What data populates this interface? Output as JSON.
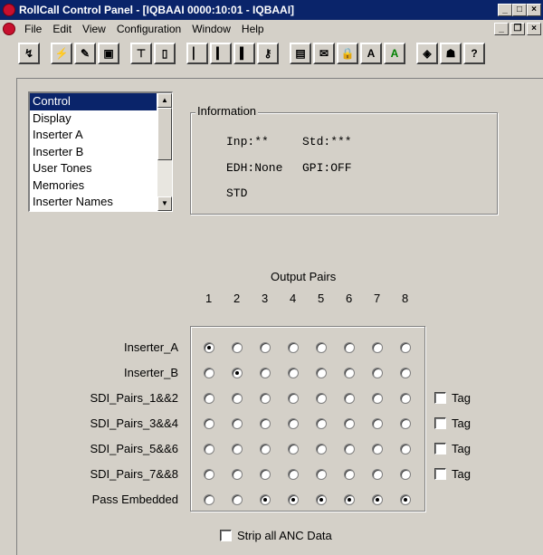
{
  "window": {
    "title": "RollCall Control Panel - [IQBAAI 0000:10:01 - IQBAAI]"
  },
  "menu": [
    "File",
    "Edit",
    "View",
    "Configuration",
    "Window",
    "Help"
  ],
  "toolbar": [
    "",
    "",
    "",
    "",
    "",
    "",
    "",
    "",
    "",
    "",
    "",
    "",
    "A",
    "A",
    "",
    "",
    ""
  ],
  "list": {
    "items": [
      "Control",
      "Display",
      "Inserter A",
      "Inserter B",
      "User Tones",
      "Memories",
      "Inserter Names"
    ],
    "selected": "Control"
  },
  "information": {
    "legend": "Information",
    "line1_a": "Inp:**",
    "line1_b": "Std:***",
    "line2_a": "EDH:None",
    "line2_b": "GPI:OFF",
    "line3": "STD"
  },
  "matrix": {
    "title": "Output Pairs",
    "columns": [
      "1",
      "2",
      "3",
      "4",
      "5",
      "6",
      "7",
      "8"
    ],
    "rows": [
      {
        "label": "Inserter_A",
        "selected": [
          1
        ],
        "tag": null
      },
      {
        "label": "Inserter_B",
        "selected": [
          2
        ],
        "tag": null
      },
      {
        "label": "SDI_Pairs_1&&2",
        "selected": [],
        "tag": "Tag"
      },
      {
        "label": "SDI_Pairs_3&&4",
        "selected": [],
        "tag": "Tag"
      },
      {
        "label": "SDI_Pairs_5&&6",
        "selected": [],
        "tag": "Tag"
      },
      {
        "label": "SDI_Pairs_7&&8",
        "selected": [],
        "tag": "Tag"
      },
      {
        "label": "Pass Embedded",
        "selected": [
          3,
          4,
          5,
          6,
          7,
          8
        ],
        "tag": null
      }
    ]
  },
  "strip_anc": {
    "label": "Strip all ANC Data",
    "checked": false
  }
}
